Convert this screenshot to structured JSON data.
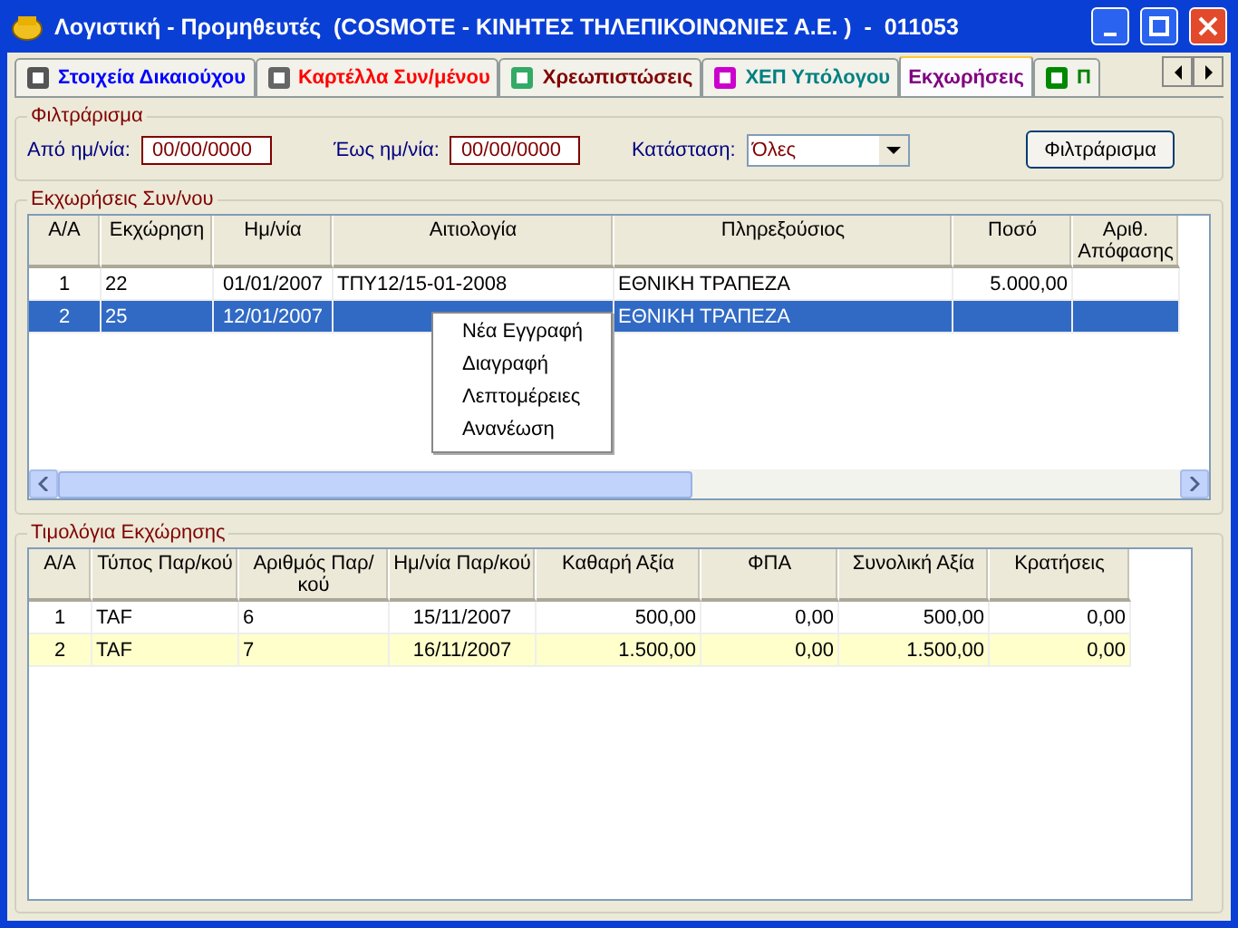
{
  "window": {
    "title": "Λογιστική - Προμηθευτές  (COSMOTE - ΚΙΝΗΤΕΣ ΤΗΛΕΠΙΚΟΙΝΩΝΙΕΣ Α.Ε. )  -  011053"
  },
  "tabs": [
    {
      "label": "Στοιχεία Δικαιούχου",
      "selected": false,
      "color": "#0000ff"
    },
    {
      "label": "Καρτέλλα Συν/μένου",
      "selected": false,
      "color": "#ff0000"
    },
    {
      "label": "Χρεωπιστώσεις",
      "selected": false,
      "color": "#800000"
    },
    {
      "label": "ΧΕΠ Υπόλογου",
      "selected": false,
      "color": "#008080"
    },
    {
      "label": "Εκχωρήσεις",
      "selected": true,
      "color": "#800080"
    },
    {
      "label": "Π",
      "selected": false,
      "color": "#008000"
    }
  ],
  "filter": {
    "title": "Φιλτράρισμα",
    "from_label": "Από ημ/νία:",
    "from_value": "00/00/0000",
    "to_label": "Έως ημ/νία:",
    "to_value": "00/00/0000",
    "status_label": "Κατάσταση:",
    "status_value": "Όλες",
    "button": "Φιλτράρισμα"
  },
  "assignments": {
    "title": "Εκχωρήσεις Συν/νου",
    "columns": [
      "Α/Α",
      "Εκχώρηση",
      "Ημ/νία",
      "Αιτιολογία",
      "Πληρεξούσιος",
      "Ποσό",
      "Αριθ. Απόφασης"
    ],
    "rows": [
      {
        "cells": [
          "1",
          "22",
          "01/01/2007",
          "ΤΠΥ12/15-01-2008",
          "ΕΘΝΙΚΗ ΤΡΑΠΕΖΑ",
          "5.000,00",
          ""
        ],
        "selected": false
      },
      {
        "cells": [
          "2",
          "25",
          "12/01/2007",
          "",
          "ΕΘΝΙΚΗ ΤΡΑΠΕΖΑ",
          "",
          ""
        ],
        "selected": true
      }
    ]
  },
  "context_menu": [
    "Νέα Εγγραφή",
    "Διαγραφή",
    "Λεπτομέρειες",
    "Ανανέωση"
  ],
  "invoices": {
    "title": "Τιμολόγια Εκχώρησης",
    "columns": [
      "Α/Α",
      "Τύπος Παρ/κού",
      "Αριθμός Παρ/κού",
      "Ημ/νία Παρ/κού",
      "Καθαρή Αξία",
      "ΦΠΑ",
      "Συνολική Αξία",
      "Κρατήσεις"
    ],
    "rows": [
      {
        "cells": [
          "1",
          "TAF",
          "6",
          "15/11/2007",
          "500,00",
          "0,00",
          "500,00",
          "0,00"
        ],
        "selected": false
      },
      {
        "cells": [
          "2",
          "TAF",
          "7",
          "16/11/2007",
          "1.500,00",
          "0,00",
          "1.500,00",
          "0,00"
        ],
        "selected": true
      }
    ]
  }
}
